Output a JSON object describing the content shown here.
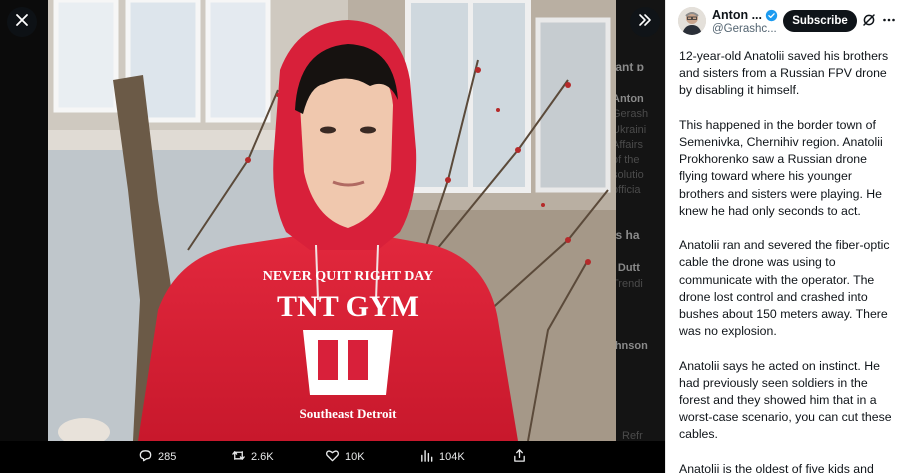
{
  "viewer": {
    "close_icon": "close-icon",
    "expand_icon": "chevron-double-right-icon",
    "photo_text": {
      "line1": "NEVER QUIT RIGHT DAY",
      "line2": "TNT GYM",
      "line3": "Southeast Detroit"
    },
    "background_hint": {
      "lines": [
        "evant p",
        "Anton",
        "Gerash",
        "Ukraini",
        "Affairs",
        "of the",
        "solutio",
        "officia",
        "at's ha",
        "he Dutt",
        "Trendi",
        "Johnson",
        "Refr"
      ]
    },
    "actions": {
      "reply": {
        "icon": "reply-icon",
        "count": "285"
      },
      "repost": {
        "icon": "repost-icon",
        "count": "2.6K"
      },
      "like": {
        "icon": "heart-icon",
        "count": "10K"
      },
      "views": {
        "icon": "views-chart-icon",
        "count": "104K"
      },
      "share": {
        "icon": "share-icon",
        "count": ""
      }
    }
  },
  "tweet": {
    "author_name": "Anton ...",
    "handle": "@Gerashc...",
    "subscribe_label": "Subscribe",
    "verified_color": "#1d9bf0",
    "paragraphs": [
      "12-year-old Anatolii saved his brothers and sisters from a Russian FPV drone by disabling it himself.",
      "This happened in the border town of Semenivka, Chernihiv region. Anatolii Prokhorenko saw a Russian drone flying toward where his younger brothers and sisters were playing. He knew he had only seconds to act.",
      "Anatolii ran and severed the fiber-optic cable the drone was using to communicate with the operator. The drone lost control and crashed into bushes about 150 meters away. There was no explosion.",
      "Anatolii says he acted on instinct. He had previously seen soldiers in the forest and they showed him that in a worst-case scenario, you can cut these cables.",
      "Anatolii is the oldest of five kids and"
    ]
  }
}
